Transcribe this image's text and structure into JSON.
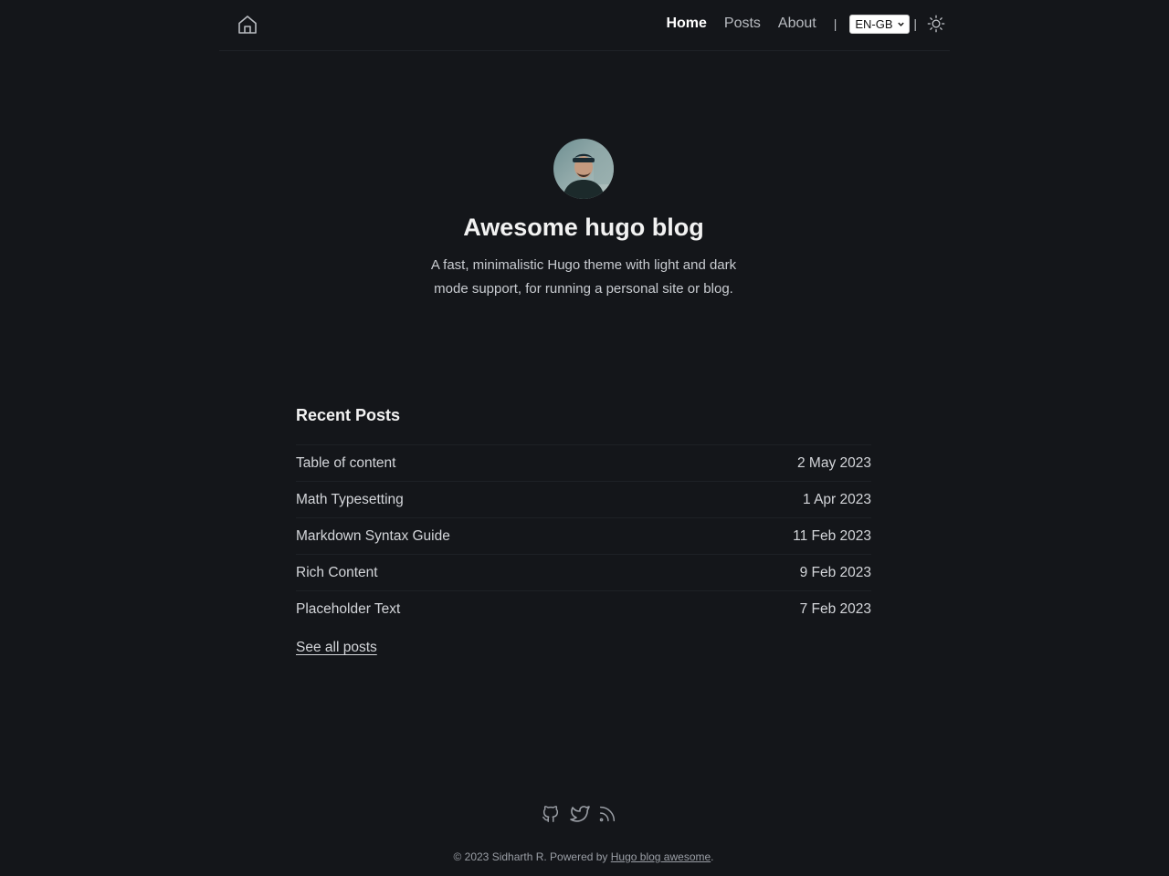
{
  "header": {
    "home_icon": "home-icon",
    "nav": [
      {
        "label": "Home",
        "active": true
      },
      {
        "label": "Posts",
        "active": false
      },
      {
        "label": "About",
        "active": false
      }
    ],
    "separator": "|",
    "language": {
      "selected": "EN-GB"
    },
    "theme_toggle_icon": "sun-icon"
  },
  "intro": {
    "title": "Awesome hugo blog",
    "description": "A fast, minimalistic Hugo theme with light and dark mode support, for running a personal site or blog."
  },
  "recent_posts": {
    "heading": "Recent Posts",
    "posts": [
      {
        "title": "Table of content",
        "date": "2 May 2023"
      },
      {
        "title": "Math Typesetting",
        "date": "1 Apr 2023"
      },
      {
        "title": "Markdown Syntax Guide",
        "date": "11 Feb 2023"
      },
      {
        "title": "Rich Content",
        "date": "9 Feb 2023"
      },
      {
        "title": "Placeholder Text",
        "date": "7 Feb 2023"
      }
    ],
    "see_all": "See all posts"
  },
  "footer": {
    "social_icons": [
      "github-icon",
      "twitter-icon",
      "rss-icon"
    ],
    "copyright": "© 2023 Sidharth R. Powered by ",
    "powered_link": "Hugo blog awesome",
    "suffix": "."
  },
  "colors": {
    "background": "#14161a",
    "text": "#e5e5e5",
    "muted": "#9a9ea5"
  }
}
